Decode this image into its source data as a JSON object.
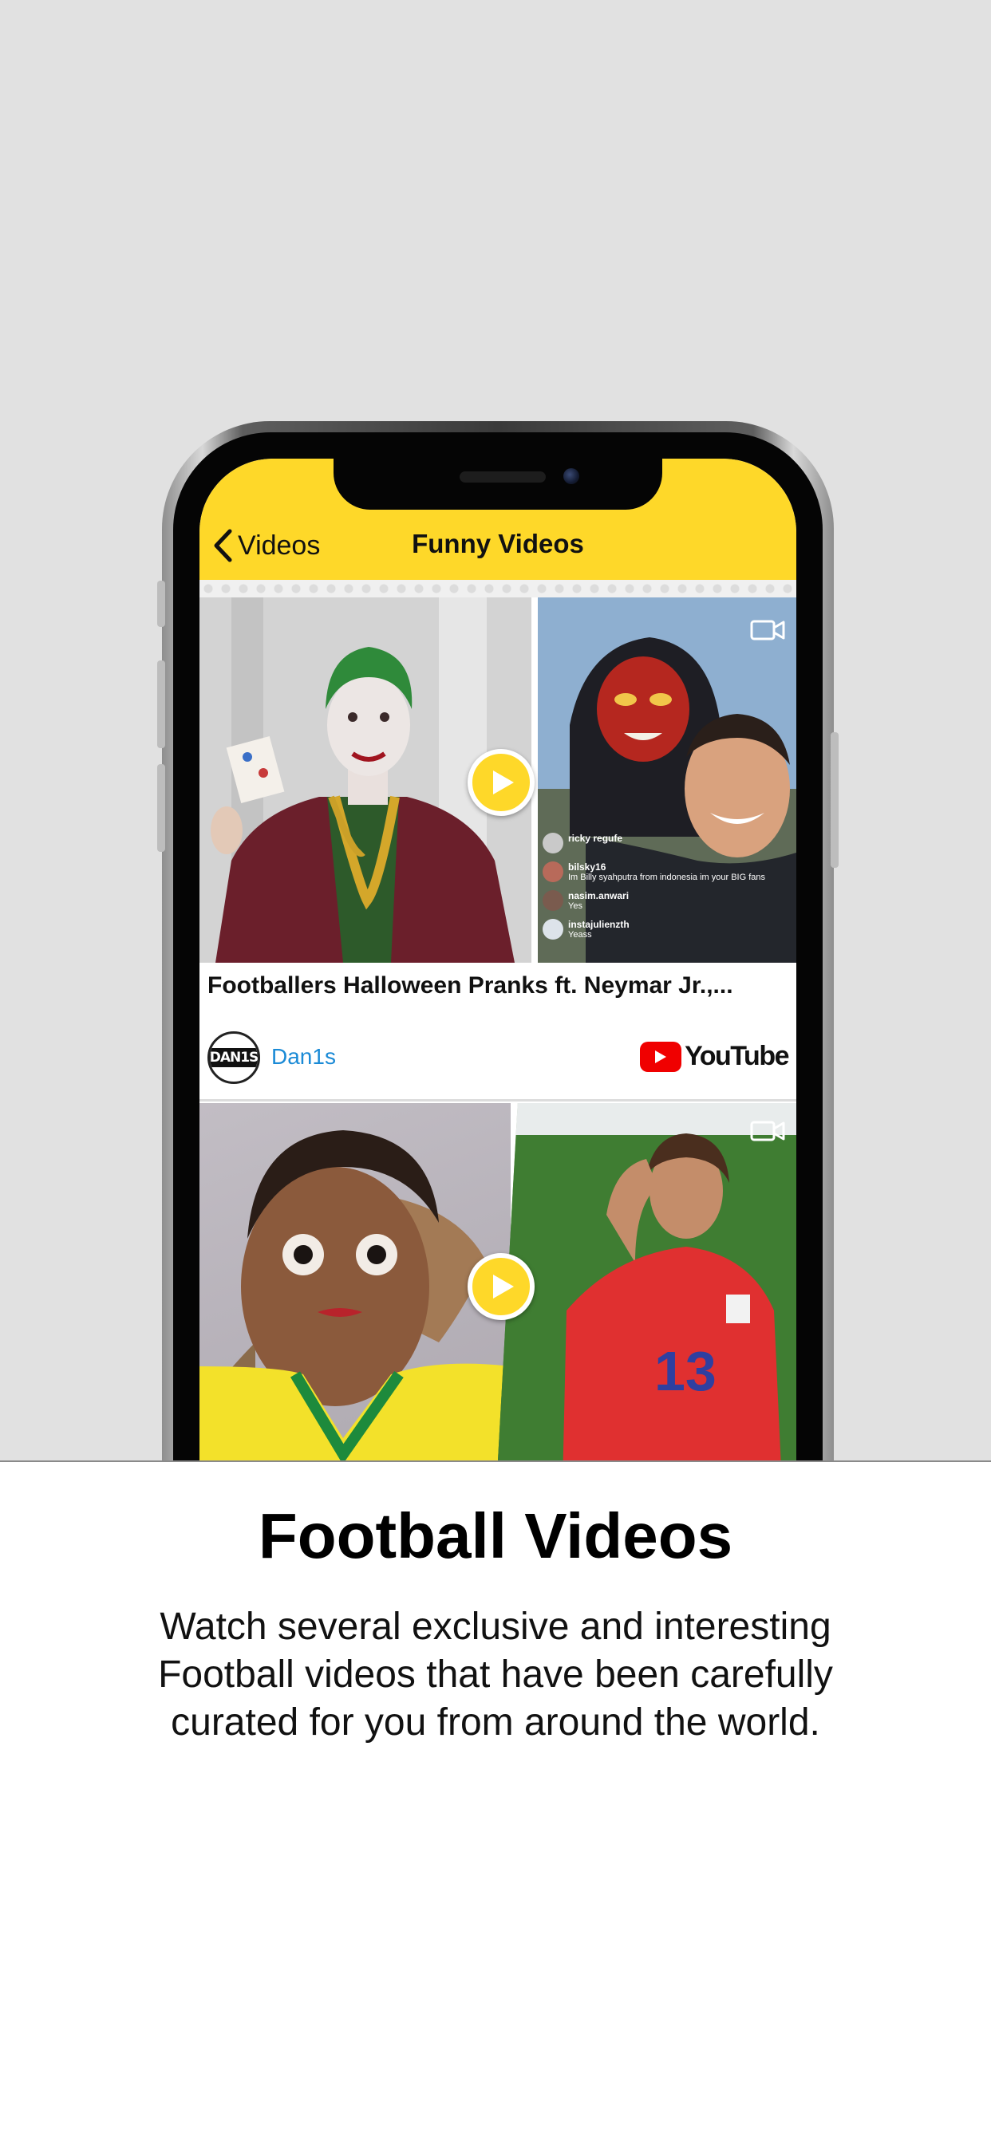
{
  "nav": {
    "back_label": "Videos",
    "title": "Funny Videos"
  },
  "videos": [
    {
      "title": "Footballers Halloween Pranks ft. Neymar Jr.,...",
      "channel": "Dan1s",
      "avatar_text": "DAN1S",
      "source": "YouTube",
      "thumbnail_overlay": [
        {
          "user": "ricky regufe",
          "text": ""
        },
        {
          "user": "bilsky16",
          "text": "Im Billy syahputra from indonesia im your BIG fans"
        },
        {
          "user": "nasim.anwari",
          "text": "Yes"
        },
        {
          "user": "instajulienzth",
          "text": "Yeass"
        }
      ]
    },
    {
      "title": "",
      "channel": "",
      "source": ""
    }
  ],
  "promo": {
    "title": "Football Videos",
    "body": "Watch several exclusive and interesting Football videos that have been carefully curated for you from around the world."
  },
  "colors": {
    "accent": "#fed829",
    "link": "#1a8ad6",
    "youtube_red": "#f00000",
    "background_top": "#e1e1e1"
  },
  "icons": {
    "back": "chevron-left-icon",
    "play": "play-icon",
    "video": "video-camera-icon"
  }
}
